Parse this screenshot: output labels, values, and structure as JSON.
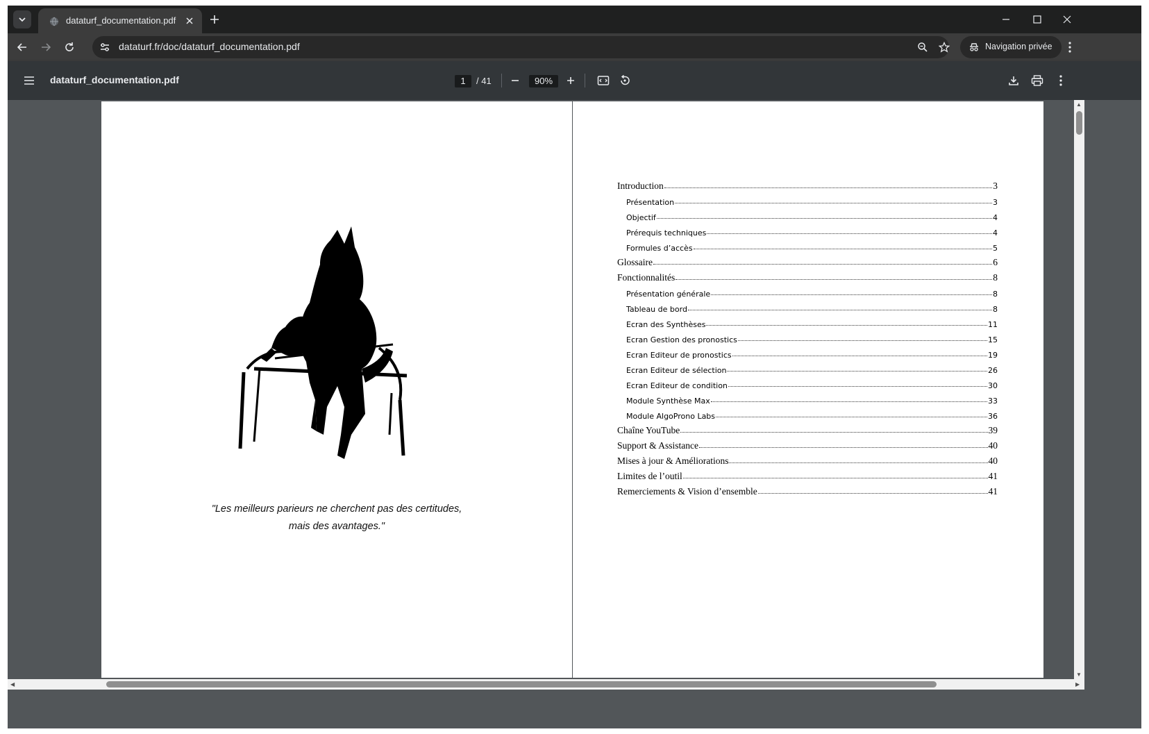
{
  "browser": {
    "tab_title": "dataturf_documentation.pdf",
    "url": "dataturf.fr/doc/dataturf_documentation.pdf",
    "incognito_label": "Navigation privée"
  },
  "pdf_toolbar": {
    "title": "dataturf_documentation.pdf",
    "current_page": "1",
    "page_total": "/ 41",
    "zoom": "90%"
  },
  "page_left": {
    "quote_line1": "\"Les meilleurs parieurs ne cherchent pas des certitudes,",
    "quote_line2": "mais des avantages.\""
  },
  "toc": [
    {
      "title": "Introduction",
      "page": "3",
      "level": 1
    },
    {
      "title": "Présentation",
      "page": "3",
      "level": 2
    },
    {
      "title": "Objectif",
      "page": "4",
      "level": 2
    },
    {
      "title": "Prérequis techniques",
      "page": "4",
      "level": 2
    },
    {
      "title": "Formules d’accès",
      "page": "5",
      "level": 2
    },
    {
      "title": "Glossaire",
      "page": "6",
      "level": 1
    },
    {
      "title": "Fonctionnalités",
      "page": "8",
      "level": 1
    },
    {
      "title": "Présentation générale",
      "page": "8",
      "level": 2
    },
    {
      "title": "Tableau de bord",
      "page": "8",
      "level": 2
    },
    {
      "title": "Ecran des Synthèses",
      "page": "11",
      "level": 2
    },
    {
      "title": "Ecran Gestion des pronostics",
      "page": "15",
      "level": 2
    },
    {
      "title": "Ecran Editeur de pronostics",
      "page": "19",
      "level": 2
    },
    {
      "title": "Ecran Editeur de sélection",
      "page": "26",
      "level": 2
    },
    {
      "title": "Ecran Editeur de condition",
      "page": "30",
      "level": 2
    },
    {
      "title": "Module Synthèse Max",
      "page": "33",
      "level": 2
    },
    {
      "title": "Module AlgoProno Labs",
      "page": "36",
      "level": 2
    },
    {
      "title": "Chaîne YouTube",
      "page": "39",
      "level": 1
    },
    {
      "title": "Support & Assistance",
      "page": "40",
      "level": 1
    },
    {
      "title": "Mises à jour & Améliorations",
      "page": "40",
      "level": 1
    },
    {
      "title": "Limites de l’outil",
      "page": "41",
      "level": 1
    },
    {
      "title": "Remerciements & Vision d’ensemble",
      "page": "41",
      "level": 1
    }
  ],
  "icons": {
    "tab_list": "chevron-down-icon",
    "favicon": "globe-icon",
    "close": "close-icon",
    "new_tab": "plus-icon",
    "back": "arrow-left-icon",
    "forward": "arrow-right-icon",
    "reload": "reload-icon",
    "site_info": "tune-icon",
    "zoom": "magnifier-icon",
    "bookmark": "star-icon",
    "incognito": "incognito-icon",
    "menu": "kebab-icon",
    "pdf_menu": "hamburger-icon",
    "zoom_out": "minus-icon",
    "zoom_in": "plus-icon",
    "fit": "fit-page-icon",
    "rotate": "rotate-icon",
    "download": "download-icon",
    "print": "print-icon"
  },
  "colors": {
    "tabstrip": "#1f2020",
    "toolbar": "#3c3c3c",
    "pdf_toolbar": "#323639",
    "viewer_bg": "#525659"
  }
}
